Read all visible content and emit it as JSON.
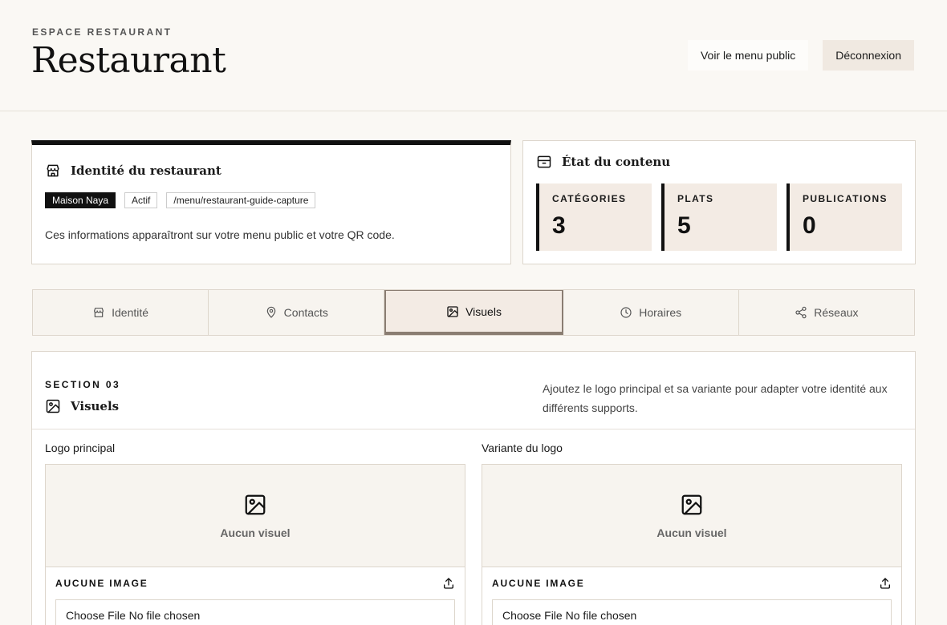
{
  "header": {
    "eyebrow": "ESPACE RESTAURANT",
    "title": "Restaurant",
    "public_menu_label": "Voir le menu public",
    "logout_label": "Déconnexion"
  },
  "identity": {
    "title": "Identité du restaurant",
    "chips": [
      "Maison Naya",
      "Actif",
      "/menu/restaurant-guide-capture"
    ],
    "description": "Ces informations apparaîtront sur votre menu public et votre QR code."
  },
  "status": {
    "title": "État du contenu",
    "stats": [
      {
        "label": "CATÉGORIES",
        "value": "3"
      },
      {
        "label": "PLATS",
        "value": "5"
      },
      {
        "label": "PUBLICATIONS",
        "value": "0"
      }
    ]
  },
  "tabs": [
    {
      "label": "Identité",
      "icon": "store-icon",
      "active": false
    },
    {
      "label": "Contacts",
      "icon": "map-pin-icon",
      "active": false
    },
    {
      "label": "Visuels",
      "icon": "image-icon",
      "active": true
    },
    {
      "label": "Horaires",
      "icon": "clock-icon",
      "active": false
    },
    {
      "label": "Réseaux",
      "icon": "share-icon",
      "active": false
    }
  ],
  "section": {
    "eyebrow": "SECTION 03",
    "title": "Visuels",
    "description": "Ajoutez le logo principal et sa variante pour adapter votre identité aux différents supports.",
    "uploads": [
      {
        "label": "Logo principal",
        "preview_text": "Aucun visuel",
        "status": "AUCUNE IMAGE",
        "file_text": "Choose File No file chosen"
      },
      {
        "label": "Variante du logo",
        "preview_text": "Aucun visuel",
        "status": "AUCUNE IMAGE",
        "file_text": "Choose File No file chosen"
      }
    ]
  }
}
